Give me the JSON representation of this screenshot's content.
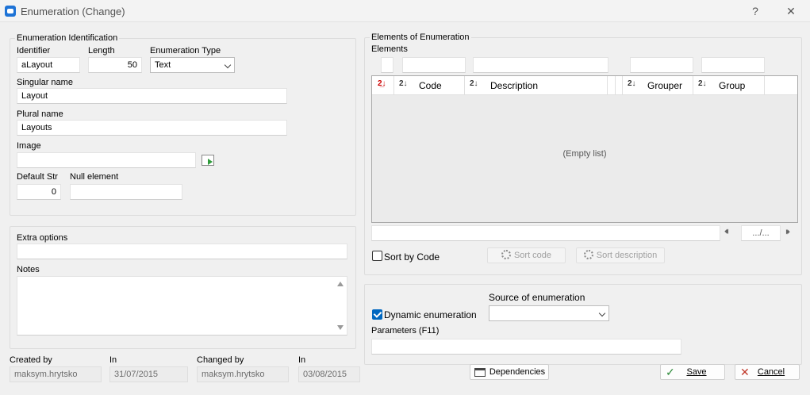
{
  "window": {
    "title": "Enumeration (Change)",
    "help": "?",
    "close": "✕"
  },
  "identification": {
    "legend": "Enumeration Identification",
    "identifier_label": "Identifier",
    "identifier_value": "aLayout",
    "length_label": "Length",
    "length_value": "50",
    "type_label": "Enumeration Type",
    "type_value": "Text",
    "singular_label": "Singular name",
    "singular_value": "Layout",
    "plural_label": "Plural name",
    "plural_value": "Layouts",
    "image_label": "Image",
    "image_value": "",
    "default_label": "Default Str",
    "default_value": "0",
    "null_label": "Null element",
    "null_value": ""
  },
  "extra": {
    "extra_label": "Extra options",
    "extra_value": "",
    "notes_label": "Notes",
    "notes_value": ""
  },
  "audit": {
    "created_by_label": "Created by",
    "created_by_value": "maksym.hrytsko",
    "created_in_label": "In",
    "created_in_value": "31/07/2015",
    "changed_by_label": "Changed by",
    "changed_by_value": "maksym.hrytsko",
    "changed_in_label": "In",
    "changed_in_value": "03/08/2015"
  },
  "elements": {
    "legend": "Elements of Enumeration",
    "sub_label": "Elements",
    "columns": [
      "Code",
      "Description",
      "Grouper",
      "Group"
    ],
    "empty_text": "(Empty list)",
    "pager_text": ".../...",
    "prev_icon": "⏴⏴",
    "next_icon": "⏵⏵",
    "sort_by_code_label": "Sort by Code",
    "sort_code_button": "Sort code",
    "sort_description_button": "Sort description"
  },
  "source": {
    "dynamic_label": "Dynamic enumeration",
    "source_label": "Source of enumeration",
    "source_value": "",
    "params_label": "Parameters (F11)",
    "params_value": ""
  },
  "buttons": {
    "dependencies": "Dependencies",
    "save": "Save",
    "cancel": "Cancel"
  },
  "colors": {
    "accent": "#0067c0",
    "save_check": "#2e8b3a",
    "cancel_x": "#c0392b"
  }
}
